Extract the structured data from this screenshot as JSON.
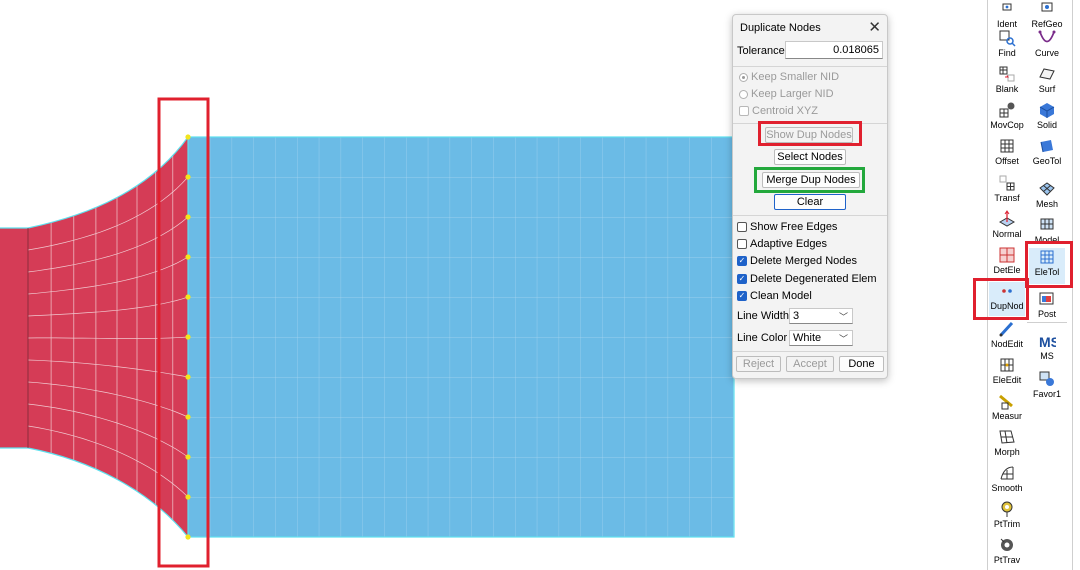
{
  "dialog": {
    "title": "Duplicate Nodes",
    "tolerance_label": "Tolerance:",
    "tolerance_value": "0.018065",
    "options": {
      "keep_smaller": "Keep Smaller NID",
      "keep_larger": "Keep Larger NID",
      "centroid": "Centroid XYZ"
    },
    "buttons": {
      "show_dup": "Show Dup Nodes",
      "select_nodes": "Select Nodes",
      "merge_dup": "Merge Dup Nodes",
      "clear": "Clear",
      "reject": "Reject",
      "accept": "Accept",
      "done": "Done"
    },
    "checks": {
      "show_free_edges": "Show Free Edges",
      "adaptive_edges": "Adaptive Edges",
      "delete_merged": "Delete Merged Nodes",
      "delete_degenerated": "Delete Degenerated Elem",
      "clean_model": "Clean Model"
    },
    "line_width_label": "Line Width",
    "line_width_value": "3",
    "line_color_label": "Line Color",
    "line_color_value": "White"
  },
  "toolbar": {
    "left": [
      "Ident",
      "Find",
      "Blank",
      "MovCop",
      "Offset",
      "Transf",
      "Normal",
      "DetEle",
      "DupNod",
      "NodEdit",
      "EleEdit",
      "Measur",
      "Morph",
      "Smooth",
      "PtTrim",
      "PtTrav"
    ],
    "right": [
      "RefGeo",
      "Curve",
      "Surf",
      "Solid",
      "GeoTol",
      "Mesh",
      "Model",
      "EleTol",
      "Post",
      "MS",
      "Favor1"
    ]
  },
  "colors": {
    "red_mesh": "#d53c56",
    "blue_mesh": "#6bbbe6",
    "mesh_edge": "#5ee0ee",
    "highlight_red": "#e0202e",
    "highlight_green": "#22a83c",
    "node_yellow": "#f2e51e",
    "accent_blue": "#1e62c9"
  }
}
